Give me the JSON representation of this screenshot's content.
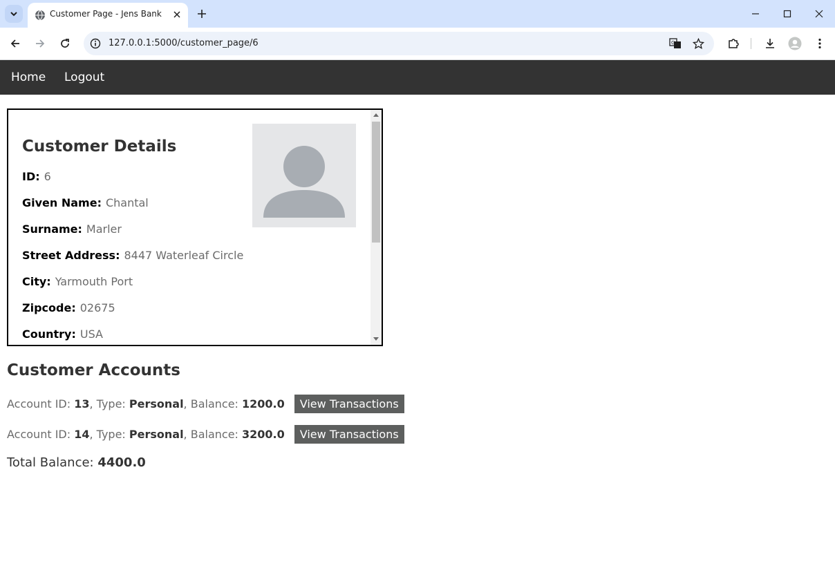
{
  "browser": {
    "tab_title": "Customer Page - Jens Bank",
    "url": "127.0.0.1:5000/customer_page/6"
  },
  "nav": {
    "home": "Home",
    "logout": "Logout"
  },
  "details": {
    "title": "Customer Details",
    "fields": [
      {
        "label": "ID:",
        "value": "6"
      },
      {
        "label": "Given Name:",
        "value": "Chantal"
      },
      {
        "label": "Surname:",
        "value": "Marler"
      },
      {
        "label": "Street Address:",
        "value": "8447 Waterleaf Circle"
      },
      {
        "label": "City:",
        "value": "Yarmouth Port"
      },
      {
        "label": "Zipcode:",
        "value": "02675"
      },
      {
        "label": "Country:",
        "value": "USA"
      }
    ]
  },
  "accounts": {
    "title": "Customer Accounts",
    "id_label": "Account ID:",
    "type_label": "Type:",
    "balance_label": "Balance:",
    "button_label": "View Transactions",
    "items": [
      {
        "id": "13",
        "type": "Personal",
        "balance": "1200.0"
      },
      {
        "id": "14",
        "type": "Personal",
        "balance": "3200.0"
      }
    ],
    "total_label": "Total Balance:",
    "total_value": "4400.0"
  },
  "colors": {
    "navbar": "#333333",
    "button": "#5d5f5e",
    "tabstrip": "#d3e3fd"
  }
}
